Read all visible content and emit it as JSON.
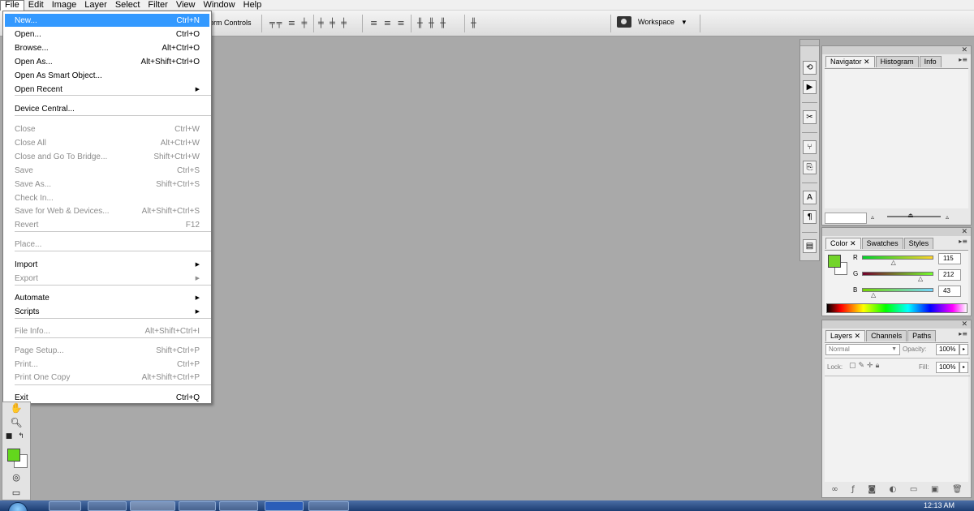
{
  "menubar": {
    "items": [
      "File",
      "Edit",
      "Image",
      "Layer",
      "Select",
      "Filter",
      "View",
      "Window",
      "Help"
    ]
  },
  "options_bar": {
    "transform_controls_label": "orm Controls",
    "workspace_label": "Workspace"
  },
  "file_menu": {
    "items": [
      {
        "label": "New...",
        "shortcut": "Ctrl+N",
        "highlighted": true
      },
      {
        "label": "Open...",
        "shortcut": "Ctrl+O"
      },
      {
        "label": "Browse...",
        "shortcut": "Alt+Ctrl+O"
      },
      {
        "label": "Open As...",
        "shortcut": "Alt+Shift+Ctrl+O"
      },
      {
        "label": "Open As Smart Object...",
        "shortcut": ""
      },
      {
        "label": "Open Recent",
        "shortcut": "",
        "submenu": true
      },
      {
        "label": "Device Central...",
        "shortcut": ""
      },
      {
        "label": "Close",
        "shortcut": "Ctrl+W",
        "disabled": true
      },
      {
        "label": "Close All",
        "shortcut": "Alt+Ctrl+W",
        "disabled": true
      },
      {
        "label": "Close and Go To Bridge...",
        "shortcut": "Shift+Ctrl+W",
        "disabled": true
      },
      {
        "label": "Save",
        "shortcut": "Ctrl+S",
        "disabled": true
      },
      {
        "label": "Save As...",
        "shortcut": "Shift+Ctrl+S",
        "disabled": true
      },
      {
        "label": "Check In...",
        "shortcut": "",
        "disabled": true
      },
      {
        "label": "Save for Web & Devices...",
        "shortcut": "Alt+Shift+Ctrl+S",
        "disabled": true
      },
      {
        "label": "Revert",
        "shortcut": "F12",
        "disabled": true
      },
      {
        "label": "Place...",
        "shortcut": "",
        "disabled": true
      },
      {
        "label": "Import",
        "shortcut": "",
        "submenu": true
      },
      {
        "label": "Export",
        "shortcut": "",
        "submenu": true,
        "disabled": true
      },
      {
        "label": "Automate",
        "shortcut": "",
        "submenu": true
      },
      {
        "label": "Scripts",
        "shortcut": "",
        "submenu": true
      },
      {
        "label": "File Info...",
        "shortcut": "Alt+Shift+Ctrl+I",
        "disabled": true
      },
      {
        "label": "Page Setup...",
        "shortcut": "Shift+Ctrl+P",
        "disabled": true
      },
      {
        "label": "Print...",
        "shortcut": "Ctrl+P",
        "disabled": true
      },
      {
        "label": "Print One Copy",
        "shortcut": "Alt+Shift+Ctrl+P",
        "disabled": true
      },
      {
        "label": "Exit",
        "shortcut": "Ctrl+Q"
      }
    ]
  },
  "navigator_panel": {
    "tabs": [
      "Navigator",
      "Histogram",
      "Info"
    ]
  },
  "color_panel": {
    "tabs": [
      "Color",
      "Swatches",
      "Styles"
    ],
    "foreground_color": "#73d42b",
    "channels": [
      {
        "label": "R",
        "value": "115",
        "fraction": 0.45
      },
      {
        "label": "G",
        "value": "212",
        "fraction": 0.83
      },
      {
        "label": "B",
        "value": "43",
        "fraction": 0.17
      }
    ]
  },
  "layers_panel": {
    "tabs": [
      "Layers",
      "Channels",
      "Paths"
    ],
    "blend_mode": "Normal",
    "opacity_label": "Opacity:",
    "opacity_value": "100%",
    "lock_label": "Lock:",
    "fill_label": "Fill:",
    "fill_value": "100%"
  },
  "tools": {
    "foreground_color": "#63d71c",
    "background_color": "#ffffff"
  },
  "taskbar": {
    "clock": "12:13 AM"
  },
  "colors": {
    "canvas_bg": "#a9a9a9",
    "menu_highlight": "#3399ff"
  }
}
